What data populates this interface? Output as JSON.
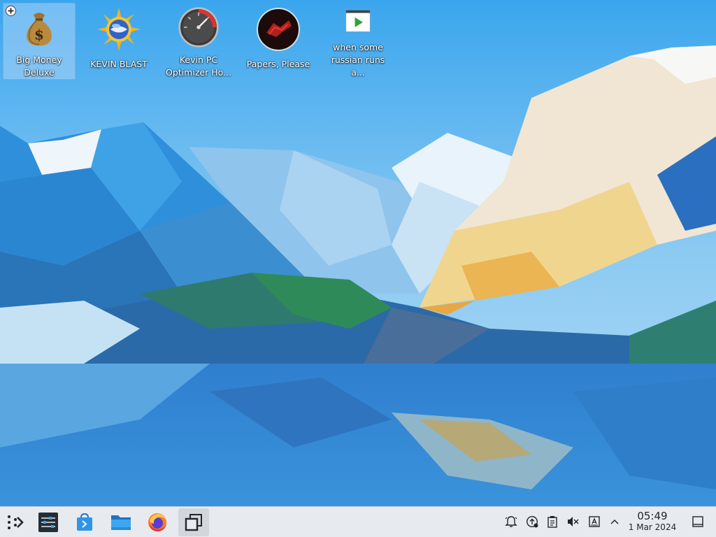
{
  "desktop": {
    "icons": [
      {
        "label": "Big Money\nDeluxe",
        "icon": "money-bag-icon",
        "selected": true
      },
      {
        "label": "KEVIN BLAST",
        "icon": "sun-globe-icon"
      },
      {
        "label": "Kevin PC\nOptimizer Ho...",
        "icon": "speedometer-icon"
      },
      {
        "label": "Papers, Please",
        "icon": "papers-please-icon"
      },
      {
        "label": "when some\nrussian runs a...",
        "icon": "video-file-icon"
      }
    ]
  },
  "taskbar": {
    "launchers": [
      {
        "icon": "app-launcher-icon"
      },
      {
        "icon": "system-settings-icon"
      },
      {
        "icon": "discover-store-icon"
      },
      {
        "icon": "file-manager-icon"
      },
      {
        "icon": "firefox-icon"
      },
      {
        "icon": "window-switcher-icon",
        "active": true
      }
    ],
    "tray": [
      {
        "icon": "notifications-bell-icon"
      },
      {
        "icon": "updates-icon"
      },
      {
        "icon": "clipboard-icon"
      },
      {
        "icon": "volume-muted-icon"
      },
      {
        "icon": "keyboard-layout-icon"
      },
      {
        "icon": "tray-expand-chevron-icon"
      }
    ],
    "clock": {
      "time": "05:49",
      "date": "1 Mar 2024"
    },
    "show_desktop": {
      "icon": "show-desktop-icon"
    }
  },
  "colors": {
    "taskbar_bg": "#e7ebef",
    "selection": "#bedcfa",
    "text_dark": "#232629"
  }
}
